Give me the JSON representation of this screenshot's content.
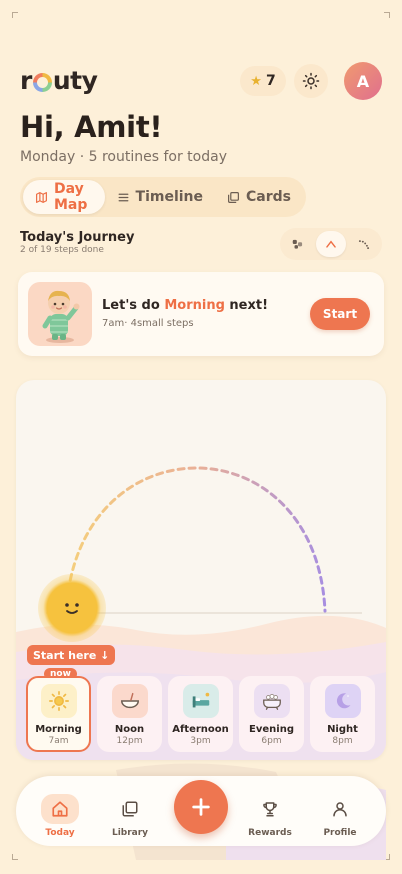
{
  "app": {
    "logo": "routy",
    "accent": "#ee7650"
  },
  "header": {
    "stars_count": "7",
    "avatar_initial": "A"
  },
  "greeting": {
    "title": "Hi, Amit!",
    "subtitle": "Monday · 5 routines for today"
  },
  "tabs": [
    {
      "label": "Day Map",
      "icon": "map-icon",
      "active": true
    },
    {
      "label": "Timeline",
      "icon": "list-icon",
      "active": false
    },
    {
      "label": "Cards",
      "icon": "cards-icon",
      "active": false
    }
  ],
  "journey": {
    "title": "Today's Journey",
    "subtitle": "2 of 19 steps done"
  },
  "next_card": {
    "prefix": "Let's do",
    "routine": "Morning",
    "suffix": "next!",
    "meta": "7am· 4small steps",
    "button": "Start"
  },
  "map": {
    "start_label": "Start here ↓",
    "now_label": "now"
  },
  "routines": [
    {
      "name": "Morning",
      "time": "7am",
      "icon": "sun-icon",
      "active": true
    },
    {
      "name": "Noon",
      "time": "12pm",
      "icon": "bowl-icon",
      "active": false
    },
    {
      "name": "Afternoon",
      "time": "3pm",
      "icon": "bed-icon",
      "active": false
    },
    {
      "name": "Evening",
      "time": "6pm",
      "icon": "bath-icon",
      "active": false
    },
    {
      "name": "Night",
      "time": "8pm",
      "icon": "moon-icon",
      "active": false
    }
  ],
  "nav": {
    "today": "Today",
    "library": "Library",
    "add": "+",
    "rewards": "Rewards",
    "profile": "Profile"
  }
}
